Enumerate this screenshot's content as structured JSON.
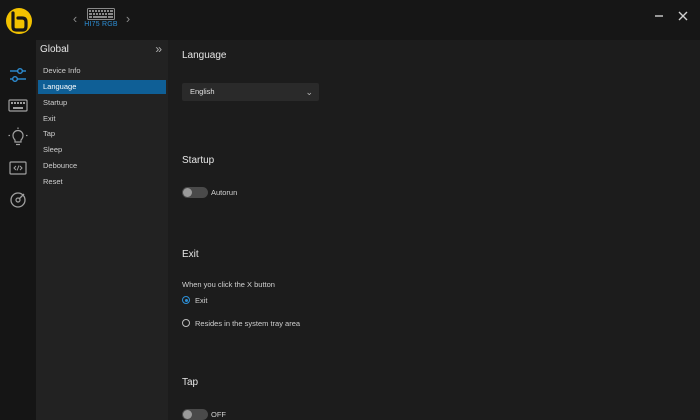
{
  "device": {
    "name": "HI75 RGB"
  },
  "sidebar": {
    "title": "Global",
    "items": [
      {
        "label": "Device Info",
        "active": false
      },
      {
        "label": "Language",
        "active": true
      },
      {
        "label": "Startup",
        "active": false
      },
      {
        "label": "Exit",
        "active": false
      },
      {
        "label": "Tap",
        "active": false
      },
      {
        "label": "Sleep",
        "active": false
      },
      {
        "label": "Debounce",
        "active": false
      },
      {
        "label": "Reset",
        "active": false
      }
    ]
  },
  "sections": {
    "language": {
      "title": "Language",
      "selected": "English"
    },
    "startup": {
      "title": "Startup",
      "toggle_label": "Autorun",
      "enabled": false
    },
    "exit": {
      "title": "Exit",
      "prompt": "When you click the X button",
      "options": [
        {
          "label": "Exit",
          "selected": true
        },
        {
          "label": "Resides in the system tray area",
          "selected": false
        }
      ]
    },
    "tap": {
      "title": "Tap",
      "toggle_label": "OFF",
      "enabled": false
    }
  },
  "colors": {
    "accent": "#2d8fd6",
    "active_item": "#0f5f96",
    "logo": "#f2c200"
  }
}
